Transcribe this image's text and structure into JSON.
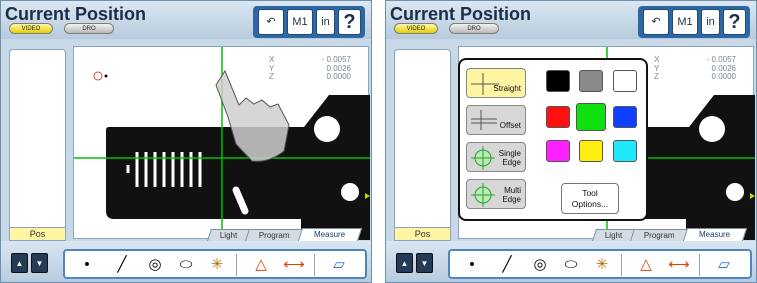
{
  "screens": [
    {
      "title": "Current Position",
      "mode_buttons": {
        "video": "VIDEO",
        "dro": "DRO"
      },
      "toolbar_buttons": {
        "undo": "↶",
        "m1": "M1",
        "units": "in",
        "help": "?"
      },
      "dro": [
        {
          "axis": "X",
          "value": "- 0.0057"
        },
        {
          "axis": "Y",
          "value": "0.0026"
        },
        {
          "axis": "Z",
          "value": "0.0000"
        }
      ],
      "left_label": "Pos",
      "tabs": [
        "Light",
        "Program",
        "Measure"
      ],
      "tools": [
        "•",
        "╱",
        "◎",
        "⬭",
        "✳",
        "△",
        "⟷",
        "▱"
      ]
    },
    {
      "title": "Current Position",
      "mode_buttons": {
        "video": "VIDEO",
        "dro": "DRO"
      },
      "toolbar_buttons": {
        "undo": "↶",
        "m1": "M1",
        "units": "in",
        "help": "?"
      },
      "dro": [
        {
          "axis": "X",
          "value": "- 0.0057"
        },
        {
          "axis": "Y",
          "value": "0.0026"
        },
        {
          "axis": "Z",
          "value": "0.0000"
        }
      ],
      "left_label": "Pos",
      "tabs": [
        "Light",
        "Program",
        "Measure"
      ],
      "tools": [
        "•",
        "╱",
        "◎",
        "⬭",
        "✳",
        "△",
        "⟷",
        "▱"
      ],
      "popup": {
        "buttons": [
          {
            "label": "Straight"
          },
          {
            "label": "Offset"
          },
          {
            "label": "Single\nEdge"
          },
          {
            "label": "Multi\nEdge"
          }
        ],
        "tool_options": "Tool\nOptions...",
        "colors": [
          "#000000",
          "#8a8a8a",
          "#ffffff",
          "#ff1010",
          "#10e010",
          "#1040ff",
          "#ff20ff",
          "#ffee10",
          "#20e8ff"
        ]
      }
    }
  ]
}
